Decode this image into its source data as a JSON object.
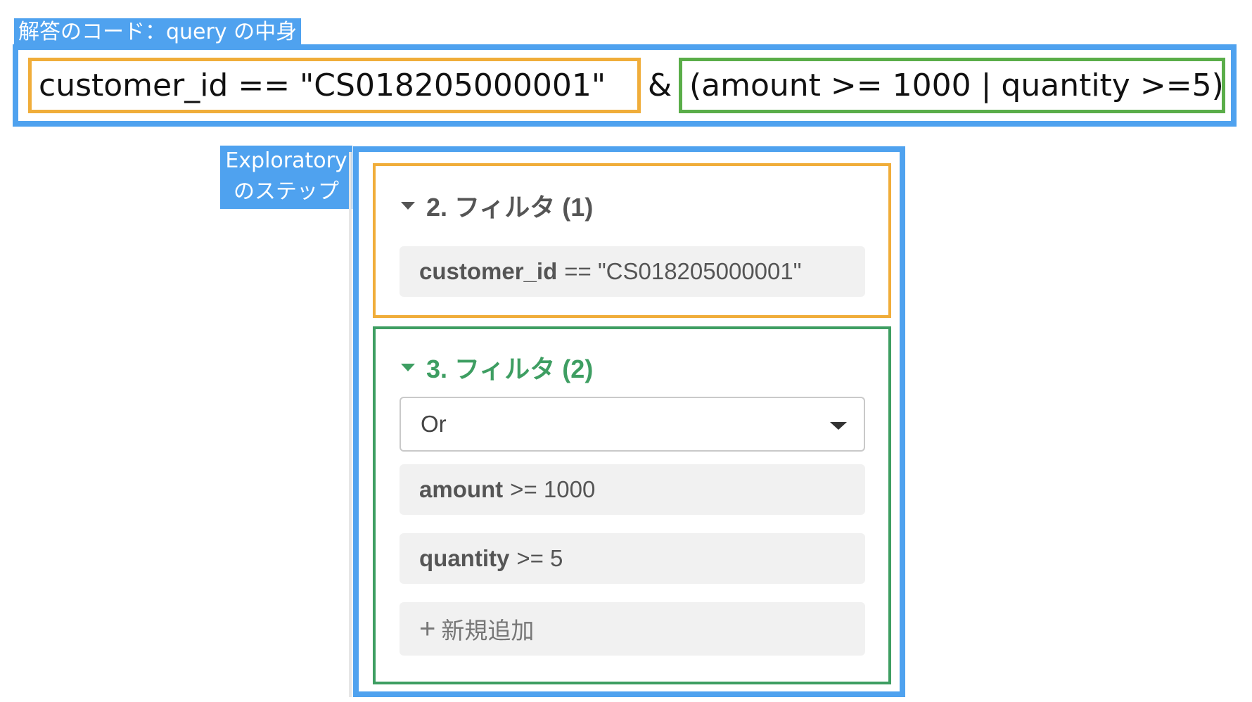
{
  "labels": {
    "code_tag": "解答のコード：query の中身",
    "steps_tag_line1": "Exploratory",
    "steps_tag_line2": "のステップ"
  },
  "code": {
    "part1": "customer_id == \"CS018205000001\"",
    "operator": "&",
    "part2": "(amount >= 1000 | quantity >=5)"
  },
  "steps": {
    "filter1": {
      "title": "2. フィルタ (1)",
      "condition_field": "customer_id",
      "condition_rest": "== \"CS018205000001\""
    },
    "filter2": {
      "title": "3. フィルタ (2)",
      "logic_selected": "Or",
      "conditions": [
        {
          "field": "amount",
          "rest": ">= 1000"
        },
        {
          "field": "quantity",
          "rest": ">= 5"
        }
      ],
      "add_icon": "+",
      "add_label": "新規追加"
    }
  },
  "colors": {
    "blue_frame": "#4fa2ef",
    "orange_highlight": "#f0ad3a",
    "green_highlight": "#5aad49",
    "step_green": "#3e9e62"
  }
}
